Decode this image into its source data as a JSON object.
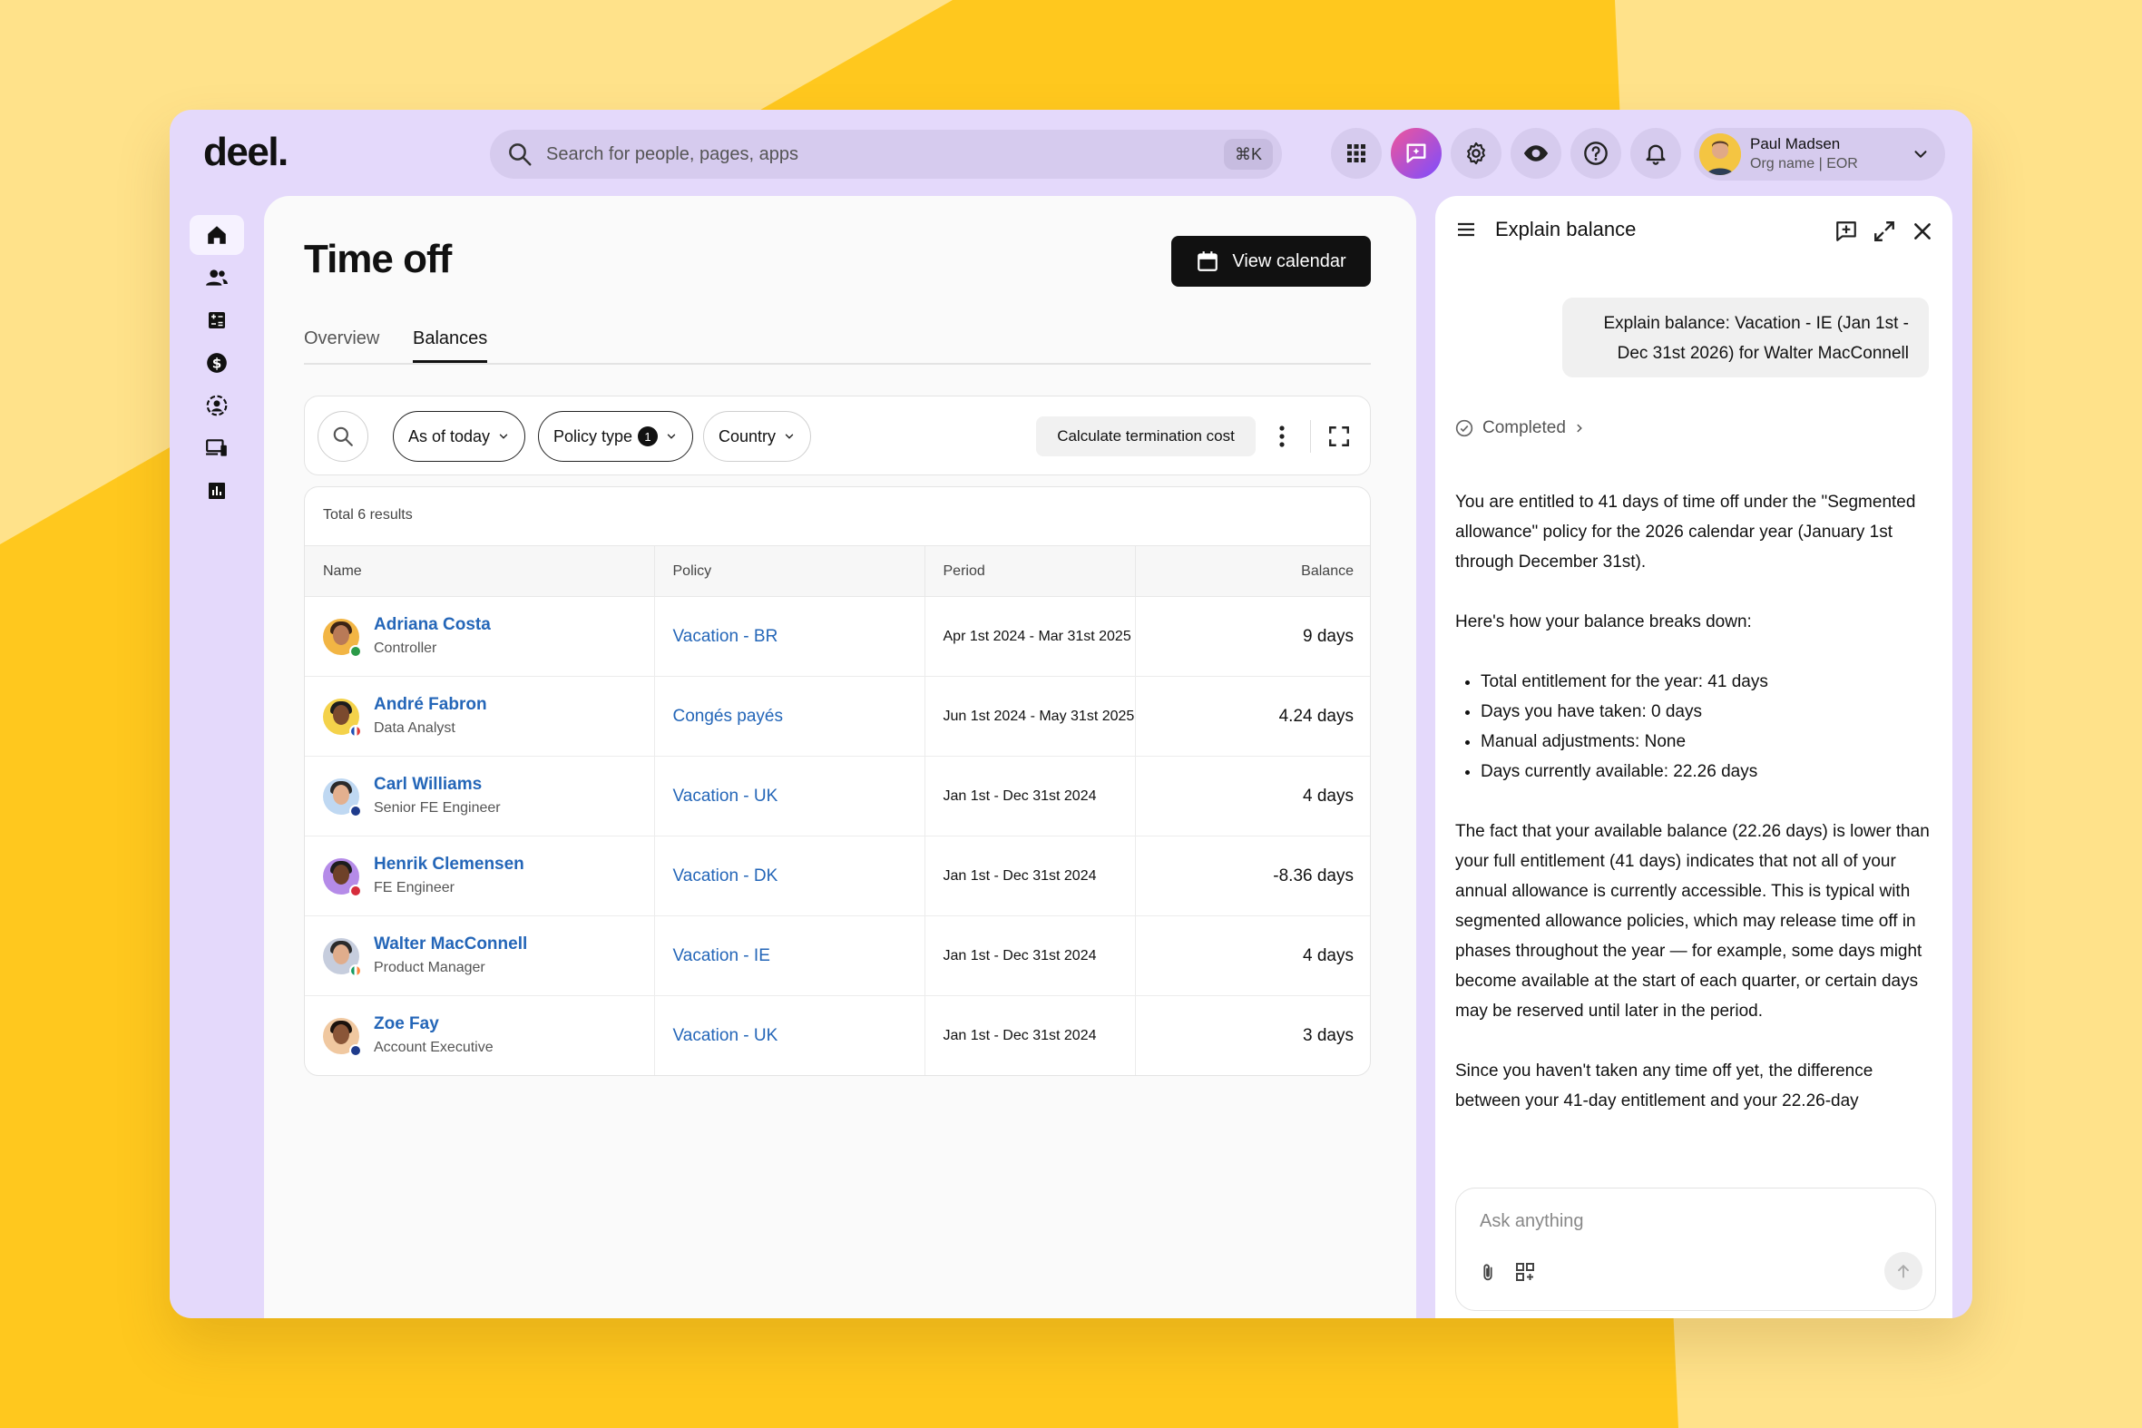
{
  "app": {
    "logo": "deel."
  },
  "topbar": {
    "search_placeholder": "Search for people, pages, apps",
    "search_shortcut": "⌘K",
    "user": {
      "name": "Paul Madsen",
      "org": "Org name | EOR"
    }
  },
  "page": {
    "title": "Time off",
    "view_calendar_label": "View calendar",
    "tabs": [
      {
        "label": "Overview"
      },
      {
        "label": "Balances"
      }
    ],
    "filters": {
      "as_of": "As of today",
      "policy_type": "Policy type",
      "policy_type_count": "1",
      "country": "Country",
      "calc_label": "Calculate termination cost"
    },
    "table": {
      "total": "Total 6 results",
      "headers": {
        "name": "Name",
        "policy": "Policy",
        "period": "Period",
        "balance": "Balance"
      },
      "rows": [
        {
          "name": "Adriana Costa",
          "role": "Controller",
          "policy": "Vacation - BR",
          "period": "Apr 1st 2024 - Mar 31st 2025",
          "balance": "9 days"
        },
        {
          "name": "André Fabron",
          "role": "Data Analyst",
          "policy": "Congés payés",
          "period": "Jun 1st 2024 - May 31st 2025",
          "balance": "4.24 days"
        },
        {
          "name": "Carl Williams",
          "role": "Senior FE Engineer",
          "policy": "Vacation - UK",
          "period": "Jan 1st - Dec 31st 2024",
          "balance": "4 days"
        },
        {
          "name": "Henrik Clemensen",
          "role": "FE Engineer",
          "policy": "Vacation - DK",
          "period": "Jan 1st - Dec 31st 2024",
          "balance": "-8.36 days"
        },
        {
          "name": "Walter MacConnell",
          "role": "Product Manager",
          "policy": "Vacation - IE",
          "period": "Jan 1st - Dec 31st 2024",
          "balance": "4 days"
        },
        {
          "name": "Zoe Fay",
          "role": "Account Executive",
          "policy": "Vacation - UK",
          "period": "Jan 1st - Dec 31st 2024",
          "balance": "3 days"
        }
      ]
    }
  },
  "assistant": {
    "title": "Explain balance",
    "question": "Explain balance: Vacation - IE (Jan 1st - Dec 31st 2026) for Walter MacConnell",
    "status": "Completed",
    "para1": "You are entitled to 41 days of time off under the \"Segmented allowance\" policy for the 2026 calendar year (January 1st through December 31st).",
    "para2": "Here's how your balance breaks down:",
    "bullets": [
      "Total entitlement for the year: 41 days",
      "Days you have taken: 0 days",
      "Manual adjustments: None",
      "Days currently available: 22.26 days"
    ],
    "para3": "The fact that your available balance (22.26 days) is lower than your full entitlement (41 days) indicates that not all of your annual allowance is currently accessible. This is typical with segmented allowance policies, which may release time off in phases throughout the year — for example, some days might become available at the start of each quarter, or certain days may be reserved until later in the period.",
    "para4": "Since you haven't taken any time off yet, the difference between your 41-day entitlement and your 22.26-day",
    "composer_placeholder": "Ask anything"
  },
  "colors": {
    "accent_purple": "#e4d9fb",
    "link_blue": "#2466b8",
    "background_yellow": "#ffd02a"
  }
}
